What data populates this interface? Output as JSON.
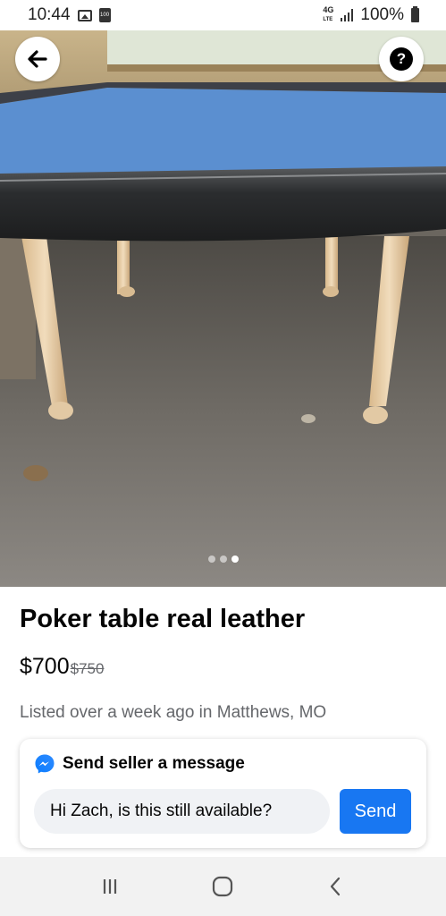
{
  "status_bar": {
    "time": "10:44",
    "sim_label": "100",
    "network": "4G",
    "network_sub": "LTE",
    "battery": "100%"
  },
  "photo": {
    "image_count": 3,
    "active_index": 2
  },
  "listing": {
    "title": "Poker table real leather",
    "price": "$700",
    "original_price": "$750",
    "meta": "Listed over a week ago in Matthews, MO"
  },
  "message_card": {
    "title": "Send seller a message",
    "input_value": "Hi Zach, is this still available?",
    "send_label": "Send"
  },
  "colors": {
    "accent": "#1877f2",
    "table_felt": "#5b8fd0",
    "leather_rail": "#2f3133"
  },
  "icons": {
    "back": "arrow-left-icon",
    "help": "question-mark-icon",
    "messenger": "messenger-icon",
    "nav_recents": "recents-icon",
    "nav_home": "home-icon",
    "nav_back": "nav-back-icon"
  }
}
